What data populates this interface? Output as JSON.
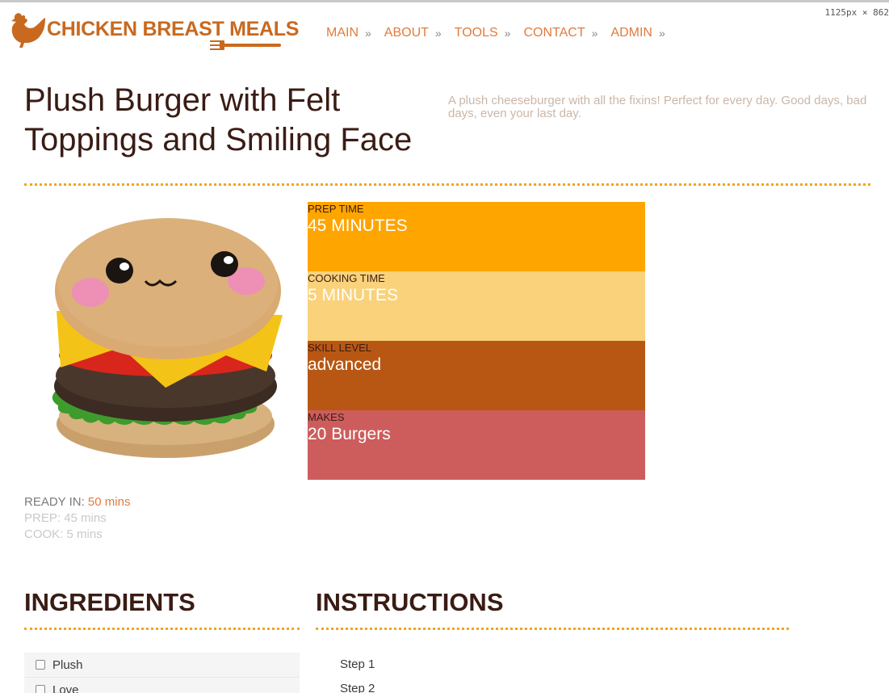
{
  "browser": {
    "dimensions_tag": "1125px × 862"
  },
  "header": {
    "logo_text": "CHICKEN BREAST MEALS",
    "nav": [
      {
        "label": "MAIN"
      },
      {
        "label": "ABOUT"
      },
      {
        "label": "TOOLS"
      },
      {
        "label": "CONTACT"
      },
      {
        "label": "ADMIN"
      }
    ],
    "nav_arrow": "»"
  },
  "recipe": {
    "title": "Plush Burger with Felt Toppings and Smiling Face",
    "description": "A plush cheeseburger with all the fixins! Perfect for every day. Good days, bad days, even your last day.",
    "stats": [
      {
        "label": "PREP TIME",
        "value": "45 MINUTES",
        "color": "#fea500"
      },
      {
        "label": "COOKING TIME",
        "value": "5 MINUTES",
        "color": "#f9d27b"
      },
      {
        "label": "SKILL LEVEL",
        "value": "advanced",
        "color": "#b85713"
      },
      {
        "label": "MAKES",
        "value": "20 Burgers",
        "color": "#cd5d5c"
      }
    ],
    "ready": {
      "ready_label": "READY IN:",
      "ready_value": "50 mins",
      "prep_label": "PREP:",
      "prep_value": "45 mins",
      "cook_label": "COOK:",
      "cook_value": "5 mins"
    }
  },
  "ingredients": {
    "heading": "INGREDIENTS",
    "items": [
      "Plush",
      "Love"
    ]
  },
  "instructions": {
    "heading": "INSTRUCTIONS",
    "steps": [
      "Step 1",
      "Step 2"
    ]
  },
  "colors": {
    "accent": "#e27b3c",
    "brand": "#c9691f",
    "divider": "#f2a51c",
    "heading": "#3a1c14"
  }
}
